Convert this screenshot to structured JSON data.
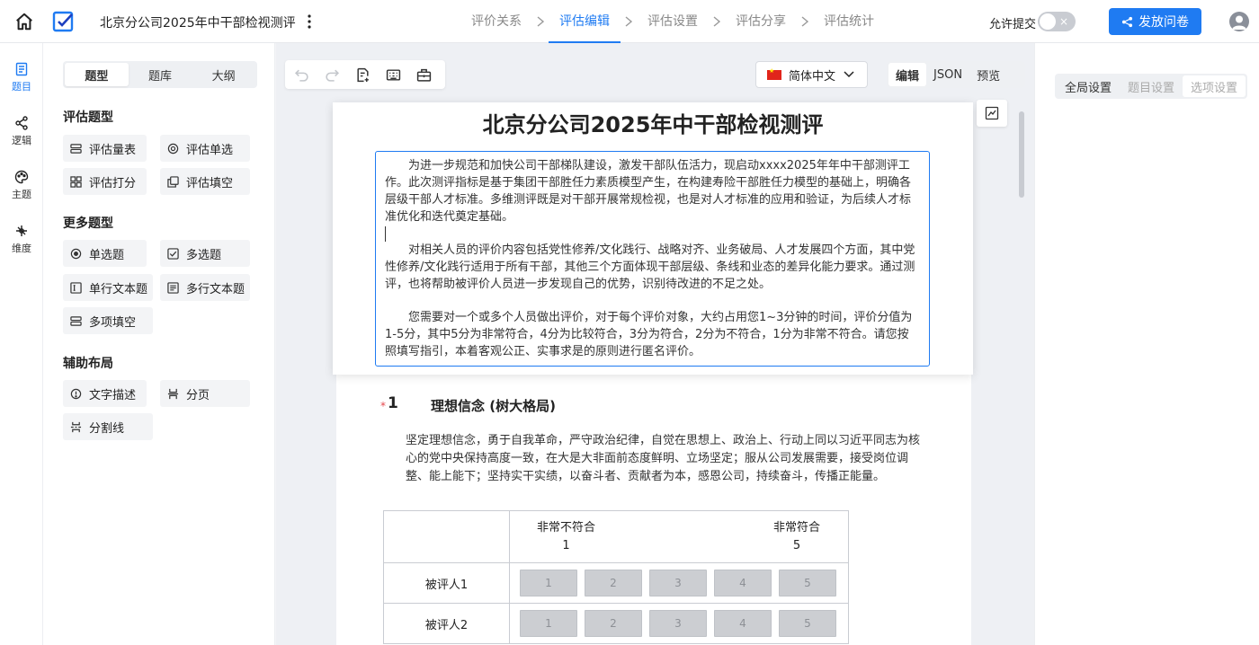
{
  "app": {
    "survey_title": "北京分公司2025年中干部检视测评",
    "steps": [
      {
        "label": "评价关系"
      },
      {
        "label": "评估编辑"
      },
      {
        "label": "评估设置"
      },
      {
        "label": "评估分享"
      },
      {
        "label": "评估统计"
      }
    ],
    "active_step": "评估编辑",
    "allow_submit_label": "允许提交",
    "allow_submit_toggle": "×",
    "publish_button": "发放问卷"
  },
  "rail": {
    "items": [
      {
        "label": "题目",
        "icon": "question-list-icon"
      },
      {
        "label": "逻辑",
        "icon": "logic-share-icon"
      },
      {
        "label": "主题",
        "icon": "palette-icon"
      },
      {
        "label": "维度",
        "icon": "dimension-icon"
      }
    ]
  },
  "panel": {
    "tabs": [
      "题型",
      "题库",
      "大纲"
    ],
    "groups": [
      {
        "title": "评估题型",
        "items": [
          "评估量表",
          "评估单选",
          "评估打分",
          "评估填空"
        ]
      },
      {
        "title": "更多题型",
        "items": [
          "单选题",
          "多选题",
          "单行文本题",
          "多行文本题",
          "多项填空"
        ]
      },
      {
        "title": "辅助布局",
        "items": [
          "文字描述",
          "分页",
          "分割线"
        ]
      }
    ]
  },
  "canvas": {
    "language": "简体中文",
    "view_tabs": [
      "编辑",
      "JSON",
      "预览"
    ],
    "doc_title": "北京分公司2025年中干部检视测评",
    "intro": [
      "为进一步规范和加快公司干部梯队建设，激发干部队伍活力，现启动xxxx2025年年中干部测评工作。此次测评指标是基于集团干部胜任力素质模型产生，在构建寿险干部胜任力模型的基础上，明确各层级干部人才标准。多维测评既是对干部开展常规检视，也是对人才标准的应用和验证，为后续人才标准优化和迭代奠定基础。",
      "对相关人员的评价内容包括党性修养/文化践行、战略对齐、业务破局、人才发展四个方面，其中党性修养/文化践行适用于所有干部，其他三个方面体现干部层级、条线和业态的差异化能力要求。通过测评，也将帮助被评价人员进一步发现自己的优势，识别待改进的不足之处。",
      "您需要对一个或多个人员做出评价，对于每个评价对象，大约占用您1~3分钟的时间，评价分值为1-5分，其中5分为非常符合，4分为比较符合，3分为符合，2分为不符合，1分为非常不符合。请您按照填写指引，本着客观公正、实事求是的原则进行匿名评价。"
    ],
    "question": {
      "required_mark": "*",
      "number": "1",
      "title": "理想信念 (树大格局)",
      "description": "坚定理想信念，勇于自我革命，严守政治纪律，自觉在思想上、政治上、行动上同以习近平同志为核心的党中央保持高度一致，在大是大非面前态度鲜明、立场坚定；服从公司发展需要，接受岗位调整、能上能下；坚持实干实绩，以奋斗者、贡献者为本，感恩公司，持续奋斗，传播正能量。",
      "scale_low_label": "非常不符合",
      "scale_low_value": "1",
      "scale_high_label": "非常符合",
      "scale_high_value": "5",
      "rows": [
        {
          "name": "被评人1",
          "options": [
            "1",
            "2",
            "3",
            "4",
            "5"
          ]
        },
        {
          "name": "被评人2",
          "options": [
            "1",
            "2",
            "3",
            "4",
            "5"
          ]
        }
      ]
    }
  },
  "right_panel": {
    "tabs": [
      "全局设置",
      "题目设置",
      "选项设置"
    ]
  },
  "colors": {
    "accent": "#1f7bf2",
    "required": "#e5484d",
    "scale_button": "#ccced2"
  }
}
